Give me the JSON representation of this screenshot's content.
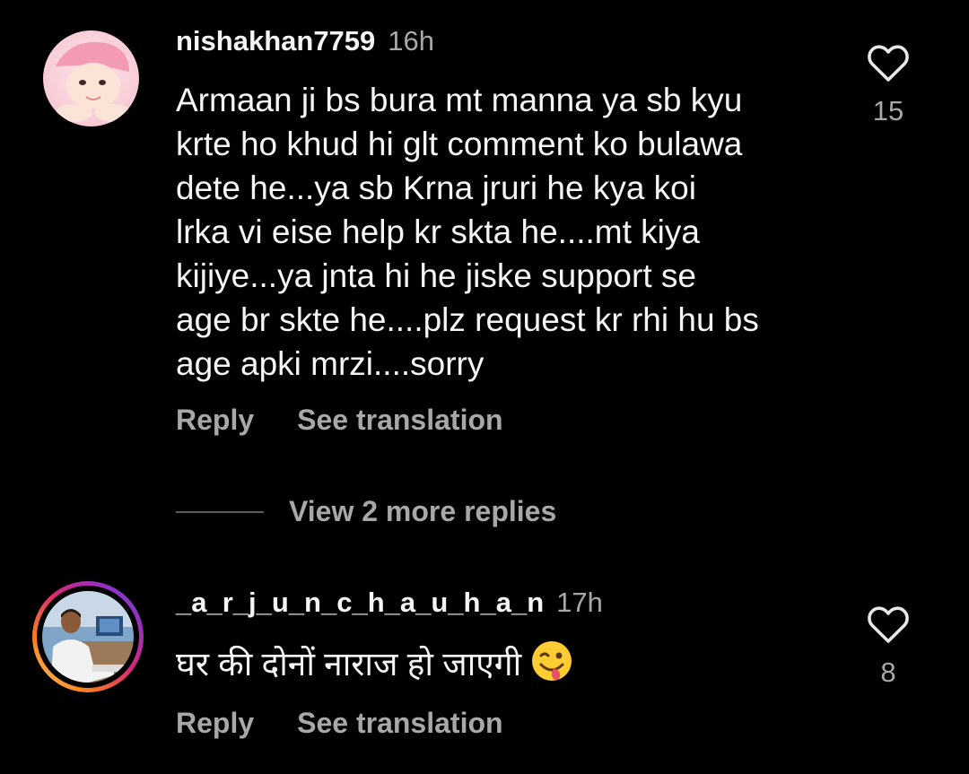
{
  "colors": {
    "background": "#000000",
    "primary_text": "#f5f5f5",
    "secondary_text": "#a8a8a8",
    "story_ring_start": "#feda75",
    "story_ring_mid": "#d62976",
    "story_ring_end": "#962fbf"
  },
  "comments": [
    {
      "username": "nishakhan7759",
      "time": "16h",
      "text": "Armaan ji bs bura mt manna ya sb kyu\nkrte ho khud hi glt comment ko bulawa\ndete he...ya sb Krna jruri he kya koi\nlrka vi eise help kr skta he....mt kiya\nkijiye...ya jnta hi he jiske support se\nage br skte he....plz request kr rhi hu bs\nage apki mrzi....sorry",
      "reply_label": "Reply",
      "translate_label": "See translation",
      "like_count": "15",
      "like_icon": "heart-outline-icon"
    },
    {
      "username": "_a_r_j_u_n_c_h_a_u_h_a_n",
      "time": "17h",
      "text": "घर की दोनों नाराज हो जाएगी",
      "emoji_icon": "winking-face-with-tongue-icon",
      "reply_label": "Reply",
      "translate_label": "See translation",
      "like_count": "8",
      "like_icon": "heart-outline-icon"
    }
  ],
  "view_replies": {
    "label": "View 2 more replies"
  }
}
